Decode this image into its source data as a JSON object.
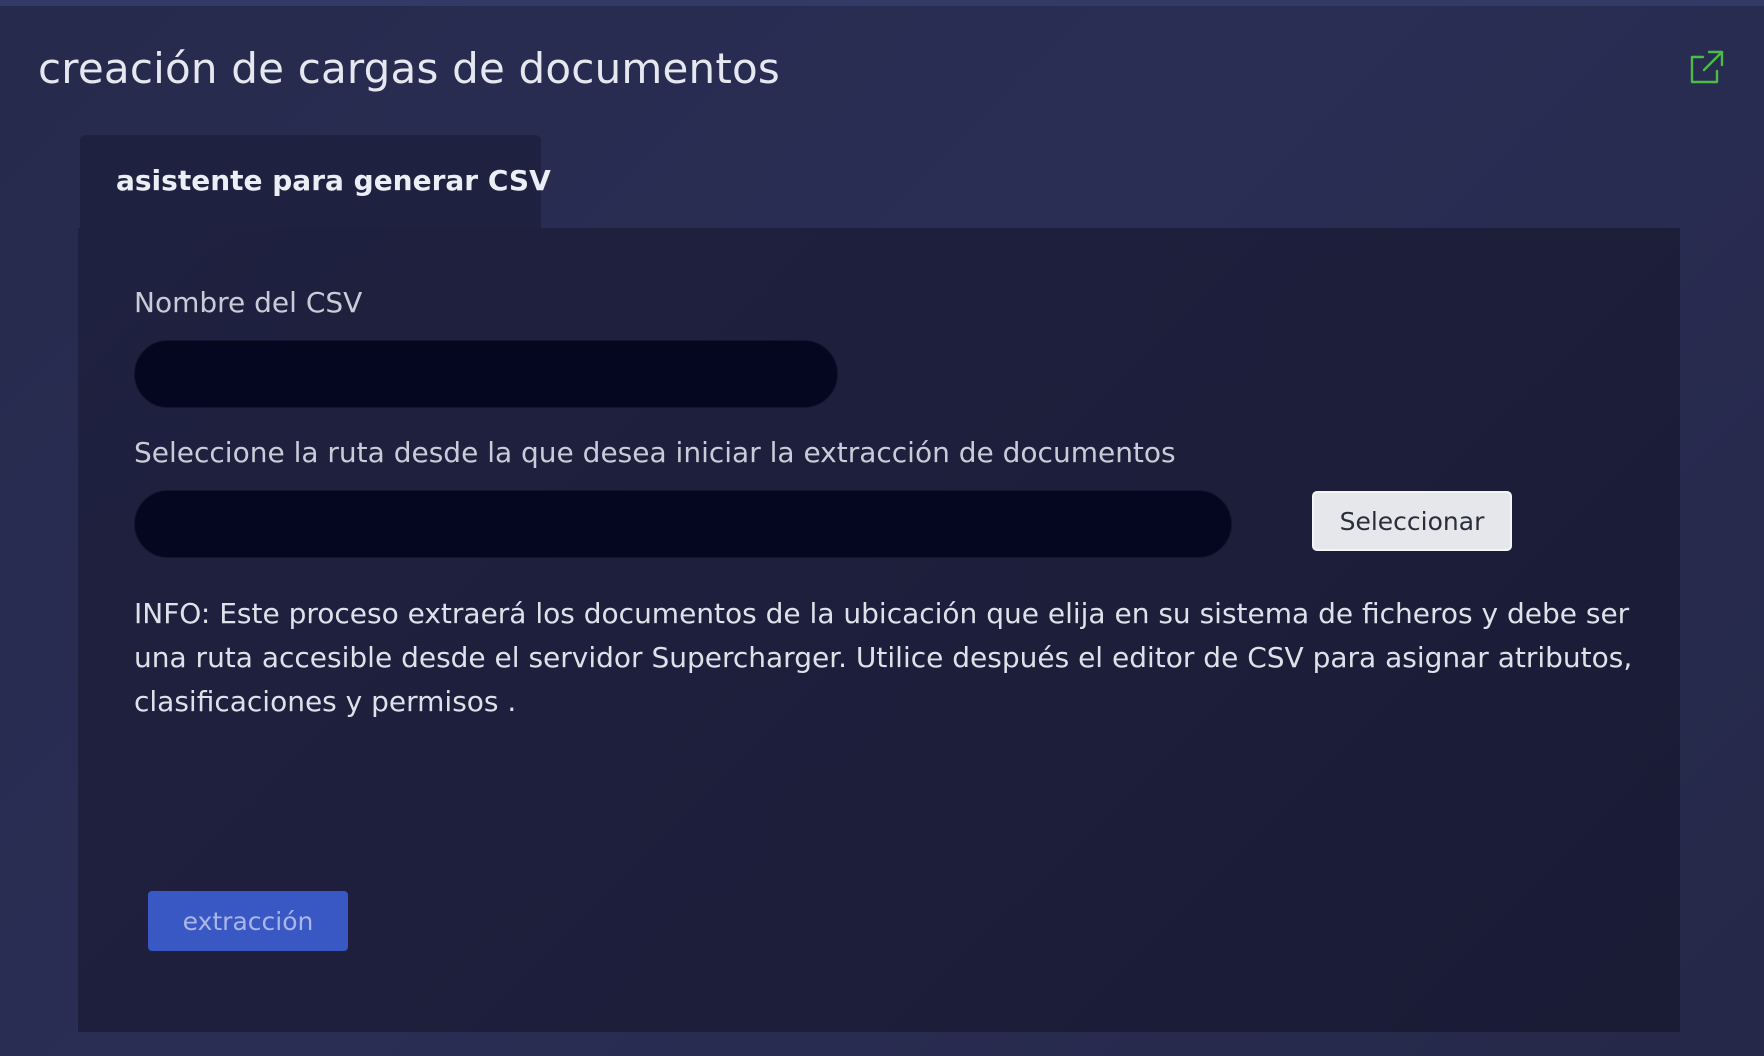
{
  "panel": {
    "title": "creación de cargas de documentos",
    "external_link_icon": "external-link-icon"
  },
  "tabs": [
    {
      "label": "asistente para generar CSV",
      "active": true
    }
  ],
  "form": {
    "csv_name": {
      "label": "Nombre del CSV",
      "value": "",
      "placeholder": ""
    },
    "path": {
      "label": "Seleccione la ruta desde la que desea iniciar la extracción de documentos",
      "value": "",
      "placeholder": ""
    },
    "select_button_label": "Seleccionar",
    "info_text": "INFO: Este proceso extraerá los documentos de la ubicación que elija en su sistema de ficheros y debe ser una ruta accesible desde el servidor Supercharger. Utilice después el editor de CSV para asignar atributos, clasificaciones y permisos .",
    "extract_button_label": "extracción"
  },
  "colors": {
    "background": "#2a2e55",
    "content_background": "#1e203e",
    "input_background": "#050720",
    "primary_button": "#3958c4",
    "icon_green": "#4cbb47"
  }
}
